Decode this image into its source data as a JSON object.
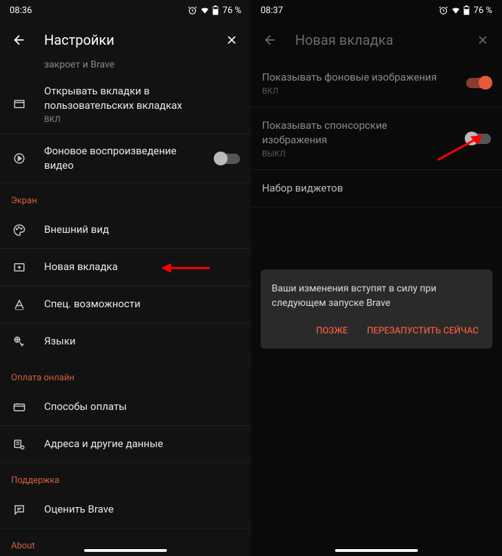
{
  "left": {
    "status": {
      "time": "08:36",
      "battery": "76 %"
    },
    "header": {
      "title": "Настройки"
    },
    "truncated_line": "закроет и Brave",
    "rows": {
      "custom_tabs": {
        "label": "Открывать вкладки в пользовательских вкладках",
        "sub": "ВКЛ"
      },
      "bg_video": {
        "label": "Фоновое воспроизведение видео"
      },
      "appearance": {
        "label": "Внешний вид"
      },
      "new_tab": {
        "label": "Новая вкладка"
      },
      "accessibility": {
        "label": "Спец. возможности"
      },
      "languages": {
        "label": "Языки"
      },
      "payment": {
        "label": "Способы оплаты"
      },
      "addresses": {
        "label": "Адреса и другие данные"
      },
      "rate": {
        "label": "Оценить Brave"
      }
    },
    "sections": {
      "screen": "Экран",
      "payment": "Оплата онлайн",
      "support": "Поддержка",
      "about": "About"
    }
  },
  "right": {
    "status": {
      "time": "08:37",
      "battery": "76 %"
    },
    "header": {
      "title": "Новая вкладка"
    },
    "rows": {
      "bg_images": {
        "label": "Показывать фоновые изображения",
        "sub": "ВКЛ"
      },
      "sponsor": {
        "label": "Показывать спонсорские изображения",
        "sub": "ВЫКЛ"
      },
      "widgets": {
        "label": "Набор виджетов"
      }
    },
    "dialog": {
      "text": "Ваши изменения вступят в силу при следующем запуске Brave",
      "later": "ПОЗЖЕ",
      "restart": "ПЕРЕЗАПУСТИТЬ СЕЙЧАС"
    }
  }
}
